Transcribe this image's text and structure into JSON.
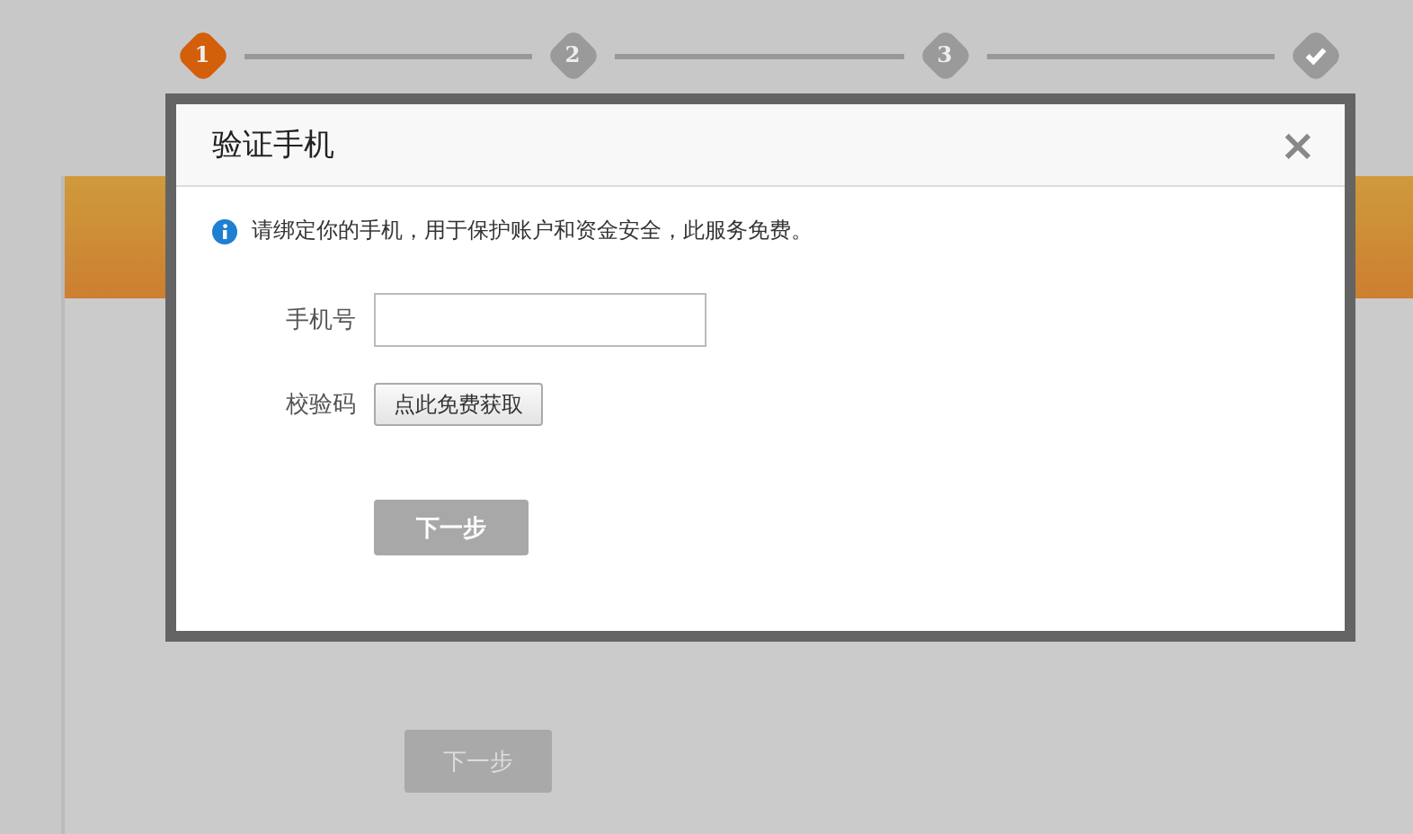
{
  "steps": [
    {
      "kind": "number",
      "label": "1",
      "selected": true
    },
    {
      "kind": "number",
      "label": "2",
      "selected": false
    },
    {
      "kind": "number",
      "label": "3",
      "selected": false
    },
    {
      "kind": "check",
      "selected": false
    }
  ],
  "background_form": {
    "next_button": {
      "label": "下一步",
      "disabled": true
    }
  },
  "dialog": {
    "title": "验证手机",
    "close": "×",
    "notice": "请绑定你的手机，用于保护账户和资金安全，此服务免费。",
    "fields": [
      {
        "kind": "input",
        "label": "手机号"
      },
      {
        "kind": "button",
        "label": "校验码",
        "button": "点此免费获取"
      }
    ],
    "next_button": {
      "label": "下一步",
      "disabled": true
    }
  }
}
